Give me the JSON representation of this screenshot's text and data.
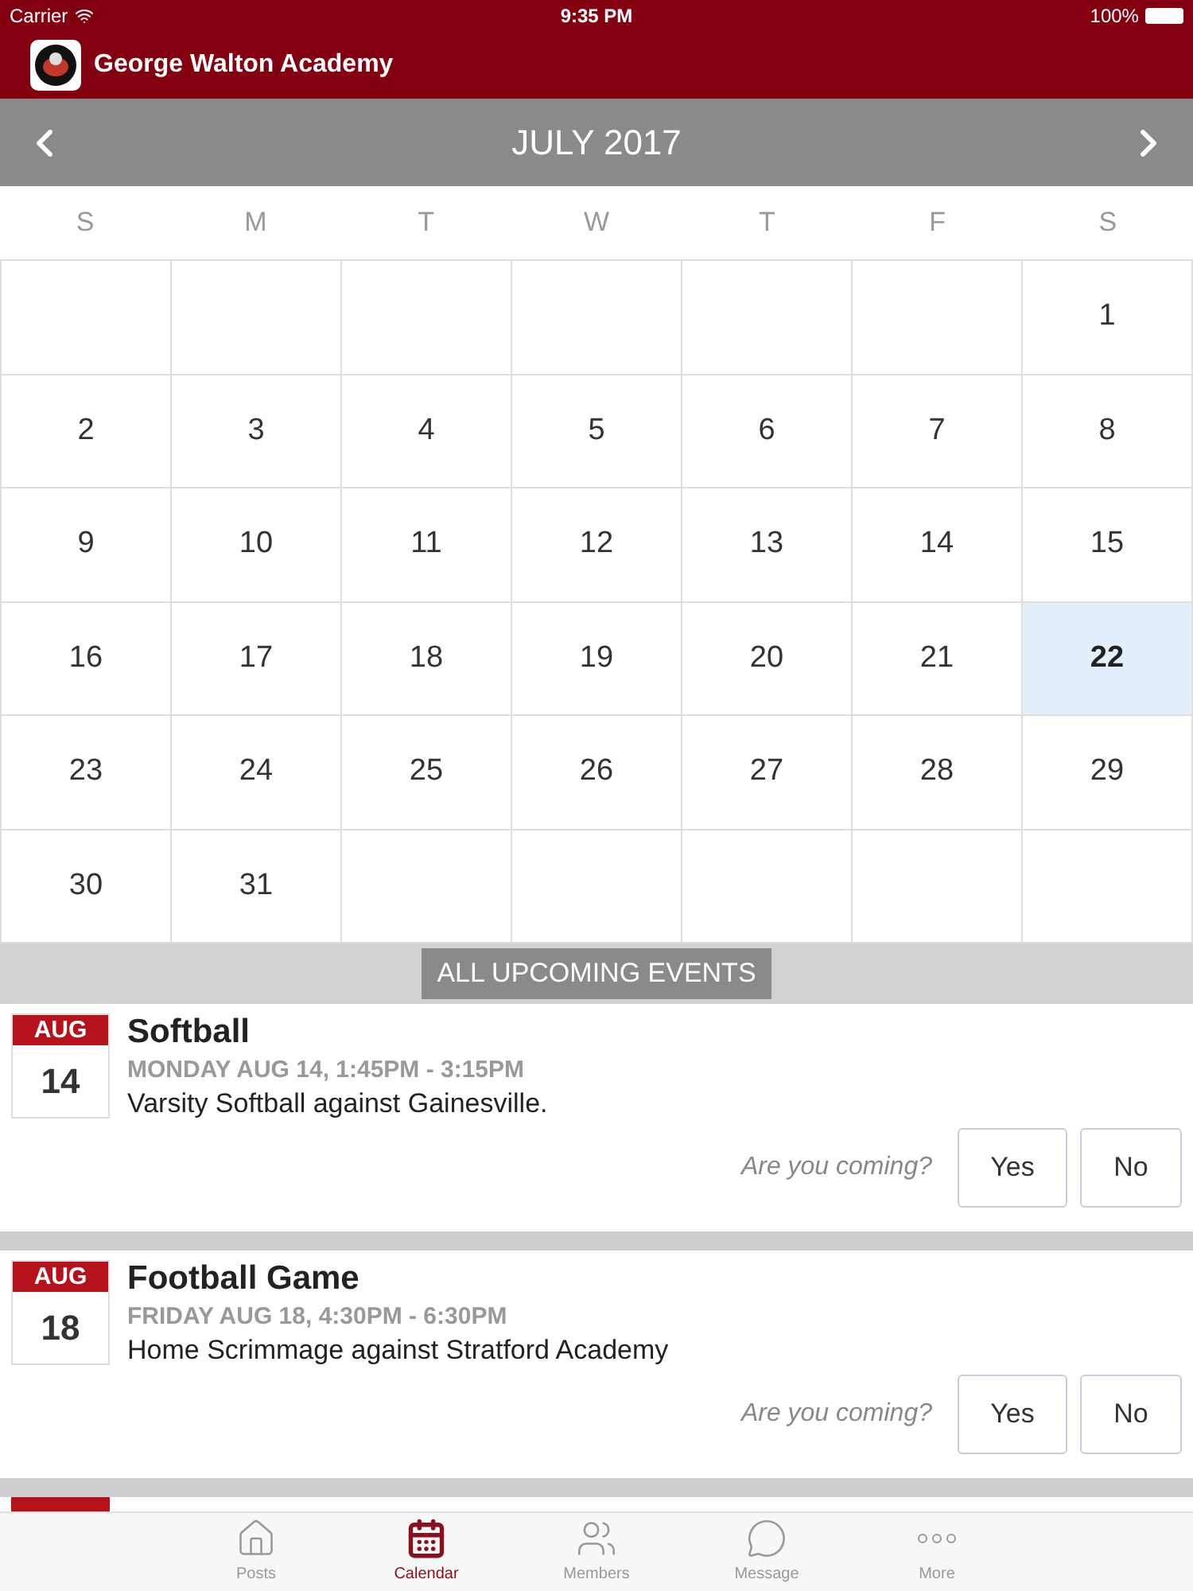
{
  "status_bar": {
    "carrier": "Carrier",
    "time": "9:35 PM",
    "battery": "100%"
  },
  "header": {
    "title": "George Walton Academy"
  },
  "calendar": {
    "month": "JULY 2017",
    "weekdays": [
      "S",
      "M",
      "T",
      "W",
      "T",
      "F",
      "S"
    ],
    "weeks": [
      [
        {
          "kind": "blank"
        },
        {
          "kind": "blank"
        },
        {
          "kind": "blank"
        },
        {
          "kind": "blank"
        },
        {
          "kind": "blank"
        },
        {
          "kind": "blank"
        },
        {
          "kind": "day",
          "label": "1",
          "selected": false
        }
      ],
      [
        {
          "kind": "day",
          "label": "2",
          "selected": false
        },
        {
          "kind": "day",
          "label": "3",
          "selected": false
        },
        {
          "kind": "day",
          "label": "4",
          "selected": false
        },
        {
          "kind": "day",
          "label": "5",
          "selected": false
        },
        {
          "kind": "day",
          "label": "6",
          "selected": false
        },
        {
          "kind": "day",
          "label": "7",
          "selected": false
        },
        {
          "kind": "day",
          "label": "8",
          "selected": false
        }
      ],
      [
        {
          "kind": "day",
          "label": "9",
          "selected": false
        },
        {
          "kind": "day",
          "label": "10",
          "selected": false
        },
        {
          "kind": "day",
          "label": "11",
          "selected": false
        },
        {
          "kind": "day",
          "label": "12",
          "selected": false
        },
        {
          "kind": "day",
          "label": "13",
          "selected": false
        },
        {
          "kind": "day",
          "label": "14",
          "selected": false
        },
        {
          "kind": "day",
          "label": "15",
          "selected": false
        }
      ],
      [
        {
          "kind": "day",
          "label": "16",
          "selected": false
        },
        {
          "kind": "day",
          "label": "17",
          "selected": false
        },
        {
          "kind": "day",
          "label": "18",
          "selected": false
        },
        {
          "kind": "day",
          "label": "19",
          "selected": false
        },
        {
          "kind": "day",
          "label": "20",
          "selected": false
        },
        {
          "kind": "day",
          "label": "21",
          "selected": false
        },
        {
          "kind": "day",
          "label": "22",
          "selected": true
        }
      ],
      [
        {
          "kind": "day",
          "label": "23",
          "selected": false
        },
        {
          "kind": "day",
          "label": "24",
          "selected": false
        },
        {
          "kind": "day",
          "label": "25",
          "selected": false
        },
        {
          "kind": "day",
          "label": "26",
          "selected": false
        },
        {
          "kind": "day",
          "label": "27",
          "selected": false
        },
        {
          "kind": "day",
          "label": "28",
          "selected": false
        },
        {
          "kind": "day",
          "label": "29",
          "selected": false
        }
      ],
      [
        {
          "kind": "day",
          "label": "30",
          "selected": false
        },
        {
          "kind": "day",
          "label": "31",
          "selected": false
        },
        {
          "kind": "blank"
        },
        {
          "kind": "blank"
        },
        {
          "kind": "blank"
        },
        {
          "kind": "blank"
        },
        {
          "kind": "blank"
        }
      ]
    ]
  },
  "events_header": "ALL UPCOMING EVENTS",
  "events": [
    {
      "month": "AUG",
      "day": "14",
      "title": "Softball",
      "when": "MONDAY AUG 14, 1:45PM - 3:15PM",
      "description": "Varsity Softball against Gainesville.",
      "prompt": "Are you coming?",
      "buttons": [
        "Yes",
        "No"
      ]
    },
    {
      "month": "AUG",
      "day": "18",
      "title": "Football Game",
      "when": "FRIDAY AUG 18, 4:30PM - 6:30PM",
      "description": "Home Scrimmage against Stratford Academy",
      "prompt": "Are you coming?",
      "buttons": [
        "Yes",
        "No"
      ]
    }
  ],
  "tab_bar": [
    {
      "label": "Posts",
      "selected": false
    },
    {
      "label": "Calendar",
      "selected": true
    },
    {
      "label": "Members",
      "selected": false
    },
    {
      "label": "Message",
      "selected": false
    },
    {
      "label": "More",
      "selected": false
    }
  ]
}
